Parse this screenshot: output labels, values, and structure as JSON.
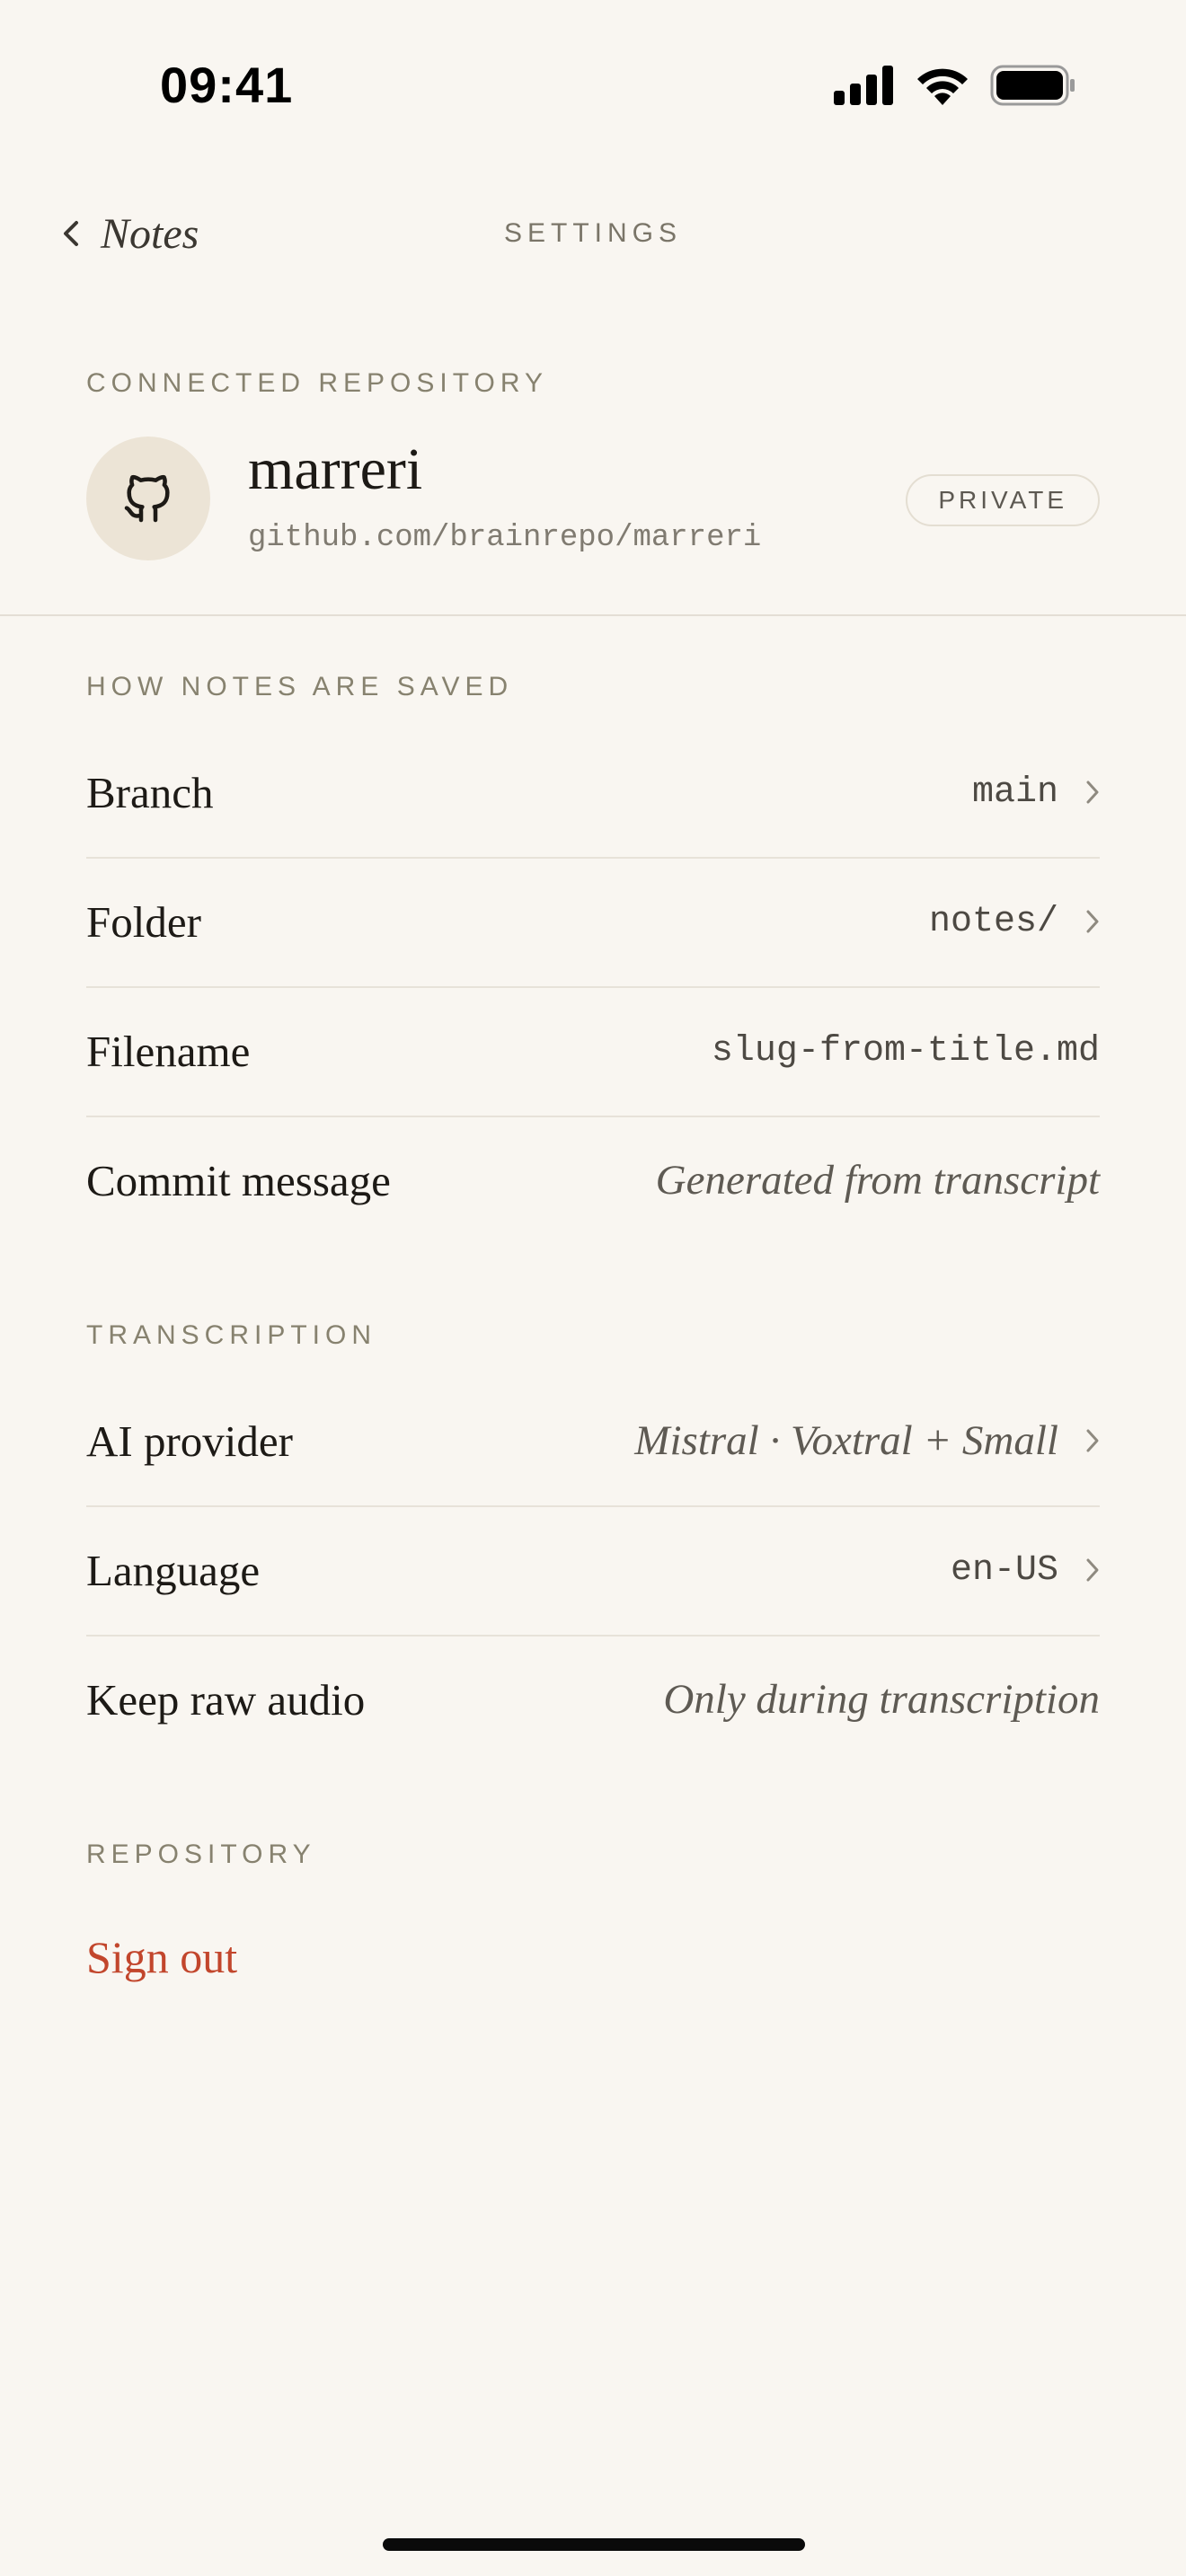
{
  "status_bar": {
    "time": "09:41"
  },
  "nav": {
    "back_label": "Notes",
    "title": "SETTINGS"
  },
  "connected_repository": {
    "section_label": "CONNECTED REPOSITORY",
    "name": "marreri",
    "url": "github.com/brainrepo/marreri",
    "badge": "PRIVATE",
    "icon": "github-icon"
  },
  "saving": {
    "section_label": "HOW NOTES ARE SAVED",
    "rows": [
      {
        "label": "Branch",
        "value": "main"
      },
      {
        "label": "Folder",
        "value": "notes/"
      },
      {
        "label": "Filename",
        "value": "slug-from-title.md"
      },
      {
        "label": "Commit message",
        "value": "Generated from transcript"
      }
    ]
  },
  "transcription": {
    "section_label": "TRANSCRIPTION",
    "rows": [
      {
        "label": "AI provider",
        "value": "Mistral · Voxtral + Small"
      },
      {
        "label": "Language",
        "value": "en-US"
      },
      {
        "label": "Keep raw audio",
        "value": "Only during transcription"
      }
    ]
  },
  "repository": {
    "section_label": "REPOSITORY",
    "sign_out_label": "Sign out"
  },
  "colors": {
    "background": "#f9f6f1",
    "accent_danger": "#c2462c",
    "muted_label": "#87826f"
  }
}
